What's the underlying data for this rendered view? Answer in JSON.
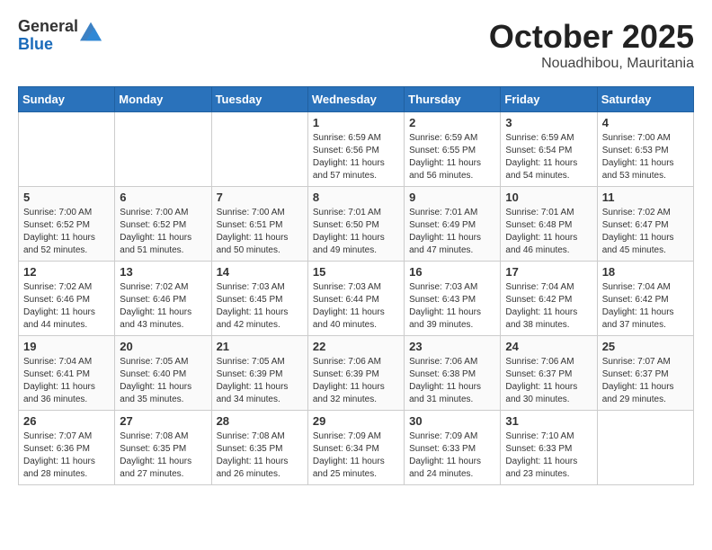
{
  "header": {
    "logo_general": "General",
    "logo_blue": "Blue",
    "month_title": "October 2025",
    "location": "Nouadhibou, Mauritania"
  },
  "weekdays": [
    "Sunday",
    "Monday",
    "Tuesday",
    "Wednesday",
    "Thursday",
    "Friday",
    "Saturday"
  ],
  "weeks": [
    [
      {
        "day": "",
        "info": ""
      },
      {
        "day": "",
        "info": ""
      },
      {
        "day": "",
        "info": ""
      },
      {
        "day": "1",
        "info": "Sunrise: 6:59 AM\nSunset: 6:56 PM\nDaylight: 11 hours\nand 57 minutes."
      },
      {
        "day": "2",
        "info": "Sunrise: 6:59 AM\nSunset: 6:55 PM\nDaylight: 11 hours\nand 56 minutes."
      },
      {
        "day": "3",
        "info": "Sunrise: 6:59 AM\nSunset: 6:54 PM\nDaylight: 11 hours\nand 54 minutes."
      },
      {
        "day": "4",
        "info": "Sunrise: 7:00 AM\nSunset: 6:53 PM\nDaylight: 11 hours\nand 53 minutes."
      }
    ],
    [
      {
        "day": "5",
        "info": "Sunrise: 7:00 AM\nSunset: 6:52 PM\nDaylight: 11 hours\nand 52 minutes."
      },
      {
        "day": "6",
        "info": "Sunrise: 7:00 AM\nSunset: 6:52 PM\nDaylight: 11 hours\nand 51 minutes."
      },
      {
        "day": "7",
        "info": "Sunrise: 7:00 AM\nSunset: 6:51 PM\nDaylight: 11 hours\nand 50 minutes."
      },
      {
        "day": "8",
        "info": "Sunrise: 7:01 AM\nSunset: 6:50 PM\nDaylight: 11 hours\nand 49 minutes."
      },
      {
        "day": "9",
        "info": "Sunrise: 7:01 AM\nSunset: 6:49 PM\nDaylight: 11 hours\nand 47 minutes."
      },
      {
        "day": "10",
        "info": "Sunrise: 7:01 AM\nSunset: 6:48 PM\nDaylight: 11 hours\nand 46 minutes."
      },
      {
        "day": "11",
        "info": "Sunrise: 7:02 AM\nSunset: 6:47 PM\nDaylight: 11 hours\nand 45 minutes."
      }
    ],
    [
      {
        "day": "12",
        "info": "Sunrise: 7:02 AM\nSunset: 6:46 PM\nDaylight: 11 hours\nand 44 minutes."
      },
      {
        "day": "13",
        "info": "Sunrise: 7:02 AM\nSunset: 6:46 PM\nDaylight: 11 hours\nand 43 minutes."
      },
      {
        "day": "14",
        "info": "Sunrise: 7:03 AM\nSunset: 6:45 PM\nDaylight: 11 hours\nand 42 minutes."
      },
      {
        "day": "15",
        "info": "Sunrise: 7:03 AM\nSunset: 6:44 PM\nDaylight: 11 hours\nand 40 minutes."
      },
      {
        "day": "16",
        "info": "Sunrise: 7:03 AM\nSunset: 6:43 PM\nDaylight: 11 hours\nand 39 minutes."
      },
      {
        "day": "17",
        "info": "Sunrise: 7:04 AM\nSunset: 6:42 PM\nDaylight: 11 hours\nand 38 minutes."
      },
      {
        "day": "18",
        "info": "Sunrise: 7:04 AM\nSunset: 6:42 PM\nDaylight: 11 hours\nand 37 minutes."
      }
    ],
    [
      {
        "day": "19",
        "info": "Sunrise: 7:04 AM\nSunset: 6:41 PM\nDaylight: 11 hours\nand 36 minutes."
      },
      {
        "day": "20",
        "info": "Sunrise: 7:05 AM\nSunset: 6:40 PM\nDaylight: 11 hours\nand 35 minutes."
      },
      {
        "day": "21",
        "info": "Sunrise: 7:05 AM\nSunset: 6:39 PM\nDaylight: 11 hours\nand 34 minutes."
      },
      {
        "day": "22",
        "info": "Sunrise: 7:06 AM\nSunset: 6:39 PM\nDaylight: 11 hours\nand 32 minutes."
      },
      {
        "day": "23",
        "info": "Sunrise: 7:06 AM\nSunset: 6:38 PM\nDaylight: 11 hours\nand 31 minutes."
      },
      {
        "day": "24",
        "info": "Sunrise: 7:06 AM\nSunset: 6:37 PM\nDaylight: 11 hours\nand 30 minutes."
      },
      {
        "day": "25",
        "info": "Sunrise: 7:07 AM\nSunset: 6:37 PM\nDaylight: 11 hours\nand 29 minutes."
      }
    ],
    [
      {
        "day": "26",
        "info": "Sunrise: 7:07 AM\nSunset: 6:36 PM\nDaylight: 11 hours\nand 28 minutes."
      },
      {
        "day": "27",
        "info": "Sunrise: 7:08 AM\nSunset: 6:35 PM\nDaylight: 11 hours\nand 27 minutes."
      },
      {
        "day": "28",
        "info": "Sunrise: 7:08 AM\nSunset: 6:35 PM\nDaylight: 11 hours\nand 26 minutes."
      },
      {
        "day": "29",
        "info": "Sunrise: 7:09 AM\nSunset: 6:34 PM\nDaylight: 11 hours\nand 25 minutes."
      },
      {
        "day": "30",
        "info": "Sunrise: 7:09 AM\nSunset: 6:33 PM\nDaylight: 11 hours\nand 24 minutes."
      },
      {
        "day": "31",
        "info": "Sunrise: 7:10 AM\nSunset: 6:33 PM\nDaylight: 11 hours\nand 23 minutes."
      },
      {
        "day": "",
        "info": ""
      }
    ]
  ]
}
